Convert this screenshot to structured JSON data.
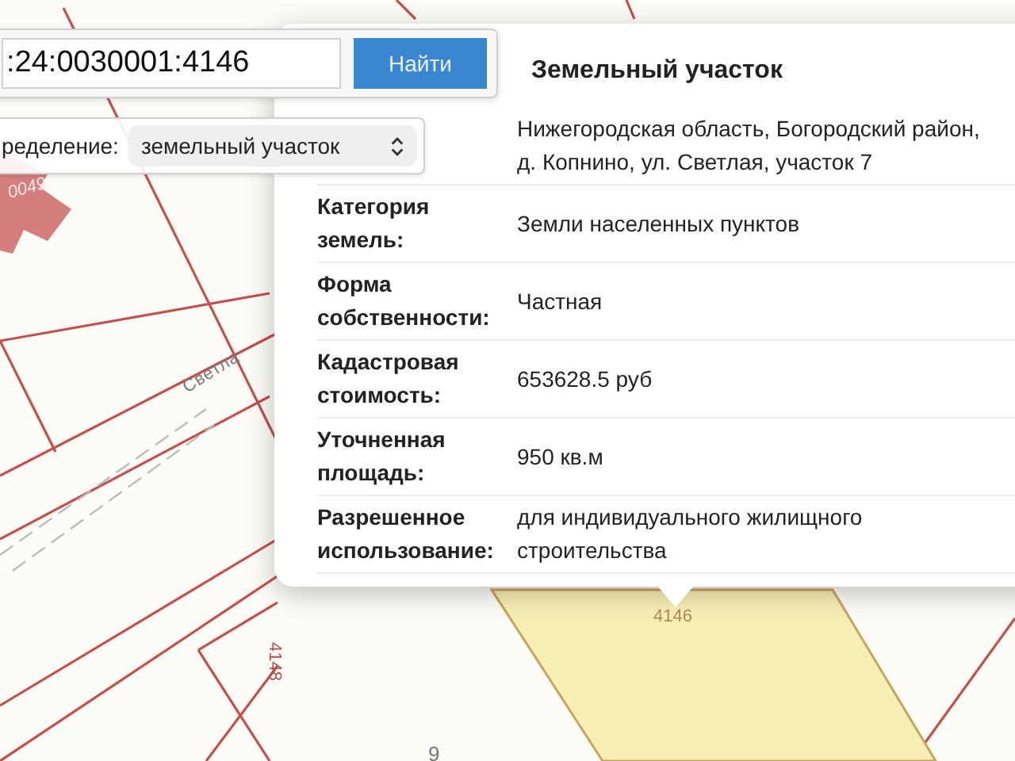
{
  "map": {
    "labels": [
      {
        "text": "0049",
        "kind": "parcel-on-building"
      },
      {
        "text": "Светла",
        "kind": "street"
      },
      {
        "text": "4148",
        "kind": "parcel"
      },
      {
        "text": "4146",
        "kind": "selected-parcel"
      },
      {
        "text": "9",
        "kind": "parcel"
      }
    ]
  },
  "search": {
    "value": ":24:0030001:4146",
    "button": "Найти"
  },
  "filter": {
    "label": "ределение:",
    "value": "земельный участок"
  },
  "popup": {
    "title": "Земельный участок",
    "rows": [
      {
        "value": "Нижегородская область, Богородский район, д. Копнино, ул. Светлая, участок 7"
      },
      {
        "label": "Категория земель:",
        "value": "Земли населенных пунктов"
      },
      {
        "label": "Форма собственности:",
        "value": "Частная"
      },
      {
        "label": "Кадастровая стоимость:",
        "value": "653628.5 руб"
      },
      {
        "label": "Уточненная площадь:",
        "value": "950 кв.м"
      },
      {
        "label": "Разрешенное использование:",
        "value": "для индивидуального жилищного строительства"
      }
    ]
  }
}
